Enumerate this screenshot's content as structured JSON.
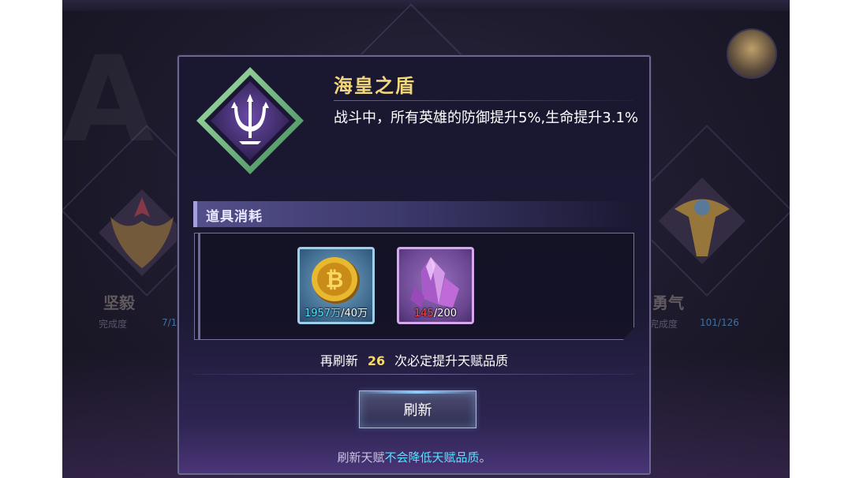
{
  "background": {
    "left_emblem_label": "坚毅",
    "left_progress_label": "完成度",
    "left_progress_value": "7/1",
    "right_emblem_label": "勇气",
    "right_progress_label": "完成度",
    "right_progress_value": "101/126"
  },
  "talent": {
    "name": "海皇之盾",
    "description": "战斗中，所有英雄的防御提升5%,生命提升3.1%",
    "icon": "trident-icon"
  },
  "cost_section": {
    "label": "道具消耗",
    "items": [
      {
        "icon": "gold-coin-icon",
        "have": "1957万",
        "need": "/40万"
      },
      {
        "icon": "purple-crystal-icon",
        "have": "145",
        "need": "/200"
      }
    ]
  },
  "refresh": {
    "prefix": "再刷新",
    "count": "26",
    "suffix": "次必定提升天赋品质",
    "button_label": "刷新"
  },
  "footer": {
    "note_plain": "刷新天赋",
    "note_highlight": "不会降低天赋品质",
    "note_end": "。"
  },
  "colors": {
    "title": "#f2d77a",
    "highlight": "#56e1ff",
    "refresh_count": "#f5d96a",
    "insufficient": "#ff4a3a"
  }
}
